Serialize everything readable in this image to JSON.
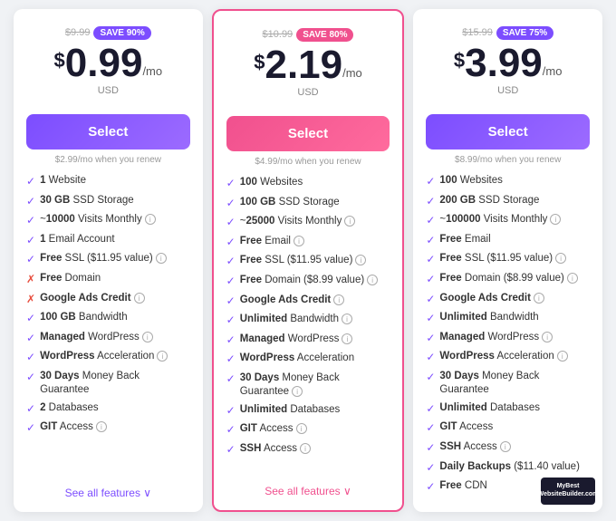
{
  "plans": [
    {
      "id": "basic",
      "originalPrice": "$9.99",
      "saveBadge": "SAVE 90%",
      "saveBadgeClass": "purple",
      "amount": "0.99",
      "period": "/mo",
      "currency": "$",
      "usd": "USD",
      "selectLabel": "Select",
      "selectBtnClass": "purple-btn",
      "renewNote": "$2.99/mo when you renew",
      "featured": false,
      "features": [
        {
          "check": true,
          "text": "",
          "bold": "1",
          "rest": " Website",
          "info": false
        },
        {
          "check": true,
          "text": "",
          "bold": "30 GB",
          "rest": " SSD Storage",
          "info": false
        },
        {
          "check": true,
          "text": "~",
          "bold": "10000",
          "rest": " Visits Monthly",
          "info": true
        },
        {
          "check": true,
          "text": "",
          "bold": "1",
          "rest": " Email Account",
          "info": false
        },
        {
          "check": true,
          "text": "",
          "bold": "Free",
          "rest": " SSL ($11.95 value)",
          "info": true
        },
        {
          "check": false,
          "text": "",
          "bold": "Free",
          "rest": " Domain",
          "info": false
        },
        {
          "check": false,
          "text": "",
          "bold": "Google Ads Credit",
          "rest": "",
          "info": true
        },
        {
          "check": true,
          "text": "",
          "bold": "100 GB",
          "rest": " Bandwidth",
          "info": false
        },
        {
          "check": true,
          "text": "",
          "bold": "Managed",
          "rest": " WordPress",
          "info": true
        },
        {
          "check": true,
          "text": "",
          "bold": "WordPress",
          "rest": " Acceleration",
          "info": true
        },
        {
          "check": true,
          "text": "",
          "bold": "30 Days",
          "rest": " Money Back Guarantee",
          "info": false
        },
        {
          "check": true,
          "text": "",
          "bold": "2",
          "rest": " Databases",
          "info": false
        },
        {
          "check": true,
          "text": "",
          "bold": "GIT",
          "rest": " Access",
          "info": true
        }
      ],
      "seeAll": "See all features ∨",
      "seeAllClass": ""
    },
    {
      "id": "premium",
      "originalPrice": "$10.99",
      "saveBadge": "SAVE 80%",
      "saveBadgeClass": "pink",
      "amount": "2.19",
      "period": "/mo",
      "currency": "$",
      "usd": "USD",
      "selectLabel": "Select",
      "selectBtnClass": "pink-btn",
      "renewNote": "$4.99/mo when you renew",
      "featured": true,
      "features": [
        {
          "check": true,
          "text": "",
          "bold": "100",
          "rest": " Websites",
          "info": false
        },
        {
          "check": true,
          "text": "",
          "bold": "100 GB",
          "rest": " SSD Storage",
          "info": false
        },
        {
          "check": true,
          "text": "~",
          "bold": "25000",
          "rest": " Visits Monthly",
          "info": true
        },
        {
          "check": true,
          "text": "",
          "bold": "Free",
          "rest": " Email",
          "info": true
        },
        {
          "check": true,
          "text": "",
          "bold": "Free",
          "rest": " SSL ($11.95 value)",
          "info": true
        },
        {
          "check": true,
          "text": "",
          "bold": "Free",
          "rest": " Domain ($8.99 value)",
          "info": true
        },
        {
          "check": true,
          "text": "",
          "bold": "Google Ads Credit",
          "rest": "",
          "info": true
        },
        {
          "check": true,
          "text": "",
          "bold": "Unlimited",
          "rest": " Bandwidth",
          "info": true
        },
        {
          "check": true,
          "text": "",
          "bold": "Managed",
          "rest": " WordPress",
          "info": true
        },
        {
          "check": true,
          "text": "",
          "bold": "WordPress",
          "rest": " Acceleration",
          "info": false
        },
        {
          "check": true,
          "text": "",
          "bold": "30 Days",
          "rest": " Money Back Guarantee",
          "info": true
        },
        {
          "check": true,
          "text": "",
          "bold": "Unlimited",
          "rest": " Databases",
          "info": false
        },
        {
          "check": true,
          "text": "",
          "bold": "GIT",
          "rest": " Access",
          "info": true
        },
        {
          "check": true,
          "text": "",
          "bold": "SSH",
          "rest": " Access",
          "info": true
        }
      ],
      "seeAll": "See all features ∨",
      "seeAllClass": "see-all-pink"
    },
    {
      "id": "business",
      "originalPrice": "$15.99",
      "saveBadge": "SAVE 75%",
      "saveBadgeClass": "blue",
      "amount": "3.99",
      "period": "/mo",
      "currency": "$",
      "usd": "USD",
      "selectLabel": "Select",
      "selectBtnClass": "purple-btn",
      "renewNote": "$8.99/mo when you renew",
      "featured": false,
      "features": [
        {
          "check": true,
          "text": "",
          "bold": "100",
          "rest": " Websites",
          "info": false
        },
        {
          "check": true,
          "text": "",
          "bold": "200 GB",
          "rest": " SSD Storage",
          "info": false
        },
        {
          "check": true,
          "text": "~",
          "bold": "100000",
          "rest": " Visits Monthly",
          "info": true
        },
        {
          "check": true,
          "text": "",
          "bold": "Free",
          "rest": " Email",
          "info": false
        },
        {
          "check": true,
          "text": "",
          "bold": "Free",
          "rest": " SSL ($11.95 value)",
          "info": true
        },
        {
          "check": true,
          "text": "",
          "bold": "Free",
          "rest": " Domain ($8.99 value)",
          "info": true
        },
        {
          "check": true,
          "text": "",
          "bold": "Google Ads Credit",
          "rest": "",
          "info": true
        },
        {
          "check": true,
          "text": "",
          "bold": "Unlimited",
          "rest": " Bandwidth",
          "info": false
        },
        {
          "check": true,
          "text": "",
          "bold": "Managed",
          "rest": " WordPress",
          "info": true
        },
        {
          "check": true,
          "text": "",
          "bold": "WordPress",
          "rest": " Acceleration",
          "info": true
        },
        {
          "check": true,
          "text": "",
          "bold": "30 Days",
          "rest": " Money Back Guarantee",
          "info": false
        },
        {
          "check": true,
          "text": "",
          "bold": "Unlimited",
          "rest": " Databases",
          "info": false
        },
        {
          "check": true,
          "text": "",
          "bold": "GIT",
          "rest": " Access",
          "info": false
        },
        {
          "check": true,
          "text": "",
          "bold": "SSH",
          "rest": " Access",
          "info": true
        },
        {
          "check": true,
          "text": "",
          "bold": "Daily Backups",
          "rest": " ($11.40 value)",
          "info": false
        },
        {
          "check": true,
          "text": "",
          "bold": "Free",
          "rest": " CDN",
          "info": false
        }
      ],
      "seeAll": "",
      "seeAllClass": ""
    }
  ]
}
